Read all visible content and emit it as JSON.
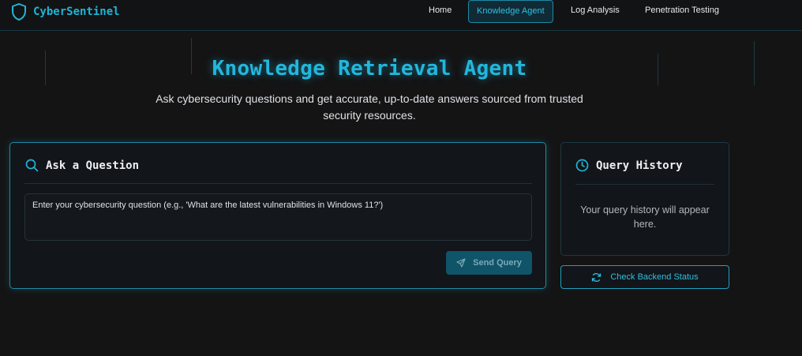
{
  "brand": {
    "name": "CyberSentinel",
    "icon": "shield-icon"
  },
  "nav": {
    "items": [
      {
        "label": "Home",
        "active": false
      },
      {
        "label": "Knowledge Agent",
        "active": true
      },
      {
        "label": "Log Analysis",
        "active": false
      },
      {
        "label": "Penetration Testing",
        "active": false
      }
    ]
  },
  "hero": {
    "title": "Knowledge Retrieval Agent",
    "subtitle": "Ask cybersecurity questions and get accurate, up-to-date answers sourced from trusted security resources."
  },
  "ask": {
    "title": "Ask a Question",
    "icon": "search-icon",
    "value": "",
    "placeholder": "Enter your cybersecurity question (e.g., 'What are the latest vulnerabilities in Windows 11?')",
    "send_label": "Send Query",
    "send_icon": "send-icon"
  },
  "history": {
    "title": "Query History",
    "icon": "clock-icon",
    "empty_text": "Your query history will appear here."
  },
  "status": {
    "label": "Check Backend Status",
    "icon": "refresh-icon"
  },
  "colors": {
    "accent": "#22b7dd",
    "background": "#141415",
    "panel": "#121519",
    "send_button": "#0f5468"
  }
}
